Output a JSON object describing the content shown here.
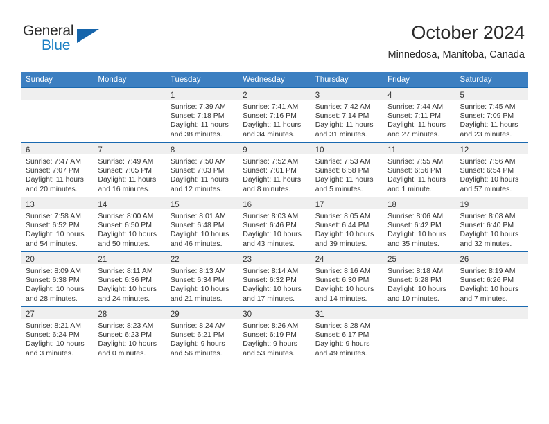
{
  "brand": {
    "name_part1": "General",
    "name_part2": "Blue",
    "accent_color": "#1b7fc4",
    "triangle_color": "#1665ab"
  },
  "header": {
    "title": "October 2024",
    "subtitle": "Minnedosa, Manitoba, Canada"
  },
  "calendar": {
    "header_bg": "#3c7fc1",
    "row_border_color": "#1a69b0",
    "daynum_band_bg": "#efefef",
    "weekdays": [
      "Sunday",
      "Monday",
      "Tuesday",
      "Wednesday",
      "Thursday",
      "Friday",
      "Saturday"
    ],
    "weeks": [
      [
        {
          "day": "",
          "lines": []
        },
        {
          "day": "",
          "lines": []
        },
        {
          "day": "1",
          "lines": [
            "Sunrise: 7:39 AM",
            "Sunset: 7:18 PM",
            "Daylight: 11 hours",
            "and 38 minutes."
          ]
        },
        {
          "day": "2",
          "lines": [
            "Sunrise: 7:41 AM",
            "Sunset: 7:16 PM",
            "Daylight: 11 hours",
            "and 34 minutes."
          ]
        },
        {
          "day": "3",
          "lines": [
            "Sunrise: 7:42 AM",
            "Sunset: 7:14 PM",
            "Daylight: 11 hours",
            "and 31 minutes."
          ]
        },
        {
          "day": "4",
          "lines": [
            "Sunrise: 7:44 AM",
            "Sunset: 7:11 PM",
            "Daylight: 11 hours",
            "and 27 minutes."
          ]
        },
        {
          "day": "5",
          "lines": [
            "Sunrise: 7:45 AM",
            "Sunset: 7:09 PM",
            "Daylight: 11 hours",
            "and 23 minutes."
          ]
        }
      ],
      [
        {
          "day": "6",
          "lines": [
            "Sunrise: 7:47 AM",
            "Sunset: 7:07 PM",
            "Daylight: 11 hours",
            "and 20 minutes."
          ]
        },
        {
          "day": "7",
          "lines": [
            "Sunrise: 7:49 AM",
            "Sunset: 7:05 PM",
            "Daylight: 11 hours",
            "and 16 minutes."
          ]
        },
        {
          "day": "8",
          "lines": [
            "Sunrise: 7:50 AM",
            "Sunset: 7:03 PM",
            "Daylight: 11 hours",
            "and 12 minutes."
          ]
        },
        {
          "day": "9",
          "lines": [
            "Sunrise: 7:52 AM",
            "Sunset: 7:01 PM",
            "Daylight: 11 hours",
            "and 8 minutes."
          ]
        },
        {
          "day": "10",
          "lines": [
            "Sunrise: 7:53 AM",
            "Sunset: 6:58 PM",
            "Daylight: 11 hours",
            "and 5 minutes."
          ]
        },
        {
          "day": "11",
          "lines": [
            "Sunrise: 7:55 AM",
            "Sunset: 6:56 PM",
            "Daylight: 11 hours",
            "and 1 minute."
          ]
        },
        {
          "day": "12",
          "lines": [
            "Sunrise: 7:56 AM",
            "Sunset: 6:54 PM",
            "Daylight: 10 hours",
            "and 57 minutes."
          ]
        }
      ],
      [
        {
          "day": "13",
          "lines": [
            "Sunrise: 7:58 AM",
            "Sunset: 6:52 PM",
            "Daylight: 10 hours",
            "and 54 minutes."
          ]
        },
        {
          "day": "14",
          "lines": [
            "Sunrise: 8:00 AM",
            "Sunset: 6:50 PM",
            "Daylight: 10 hours",
            "and 50 minutes."
          ]
        },
        {
          "day": "15",
          "lines": [
            "Sunrise: 8:01 AM",
            "Sunset: 6:48 PM",
            "Daylight: 10 hours",
            "and 46 minutes."
          ]
        },
        {
          "day": "16",
          "lines": [
            "Sunrise: 8:03 AM",
            "Sunset: 6:46 PM",
            "Daylight: 10 hours",
            "and 43 minutes."
          ]
        },
        {
          "day": "17",
          "lines": [
            "Sunrise: 8:05 AM",
            "Sunset: 6:44 PM",
            "Daylight: 10 hours",
            "and 39 minutes."
          ]
        },
        {
          "day": "18",
          "lines": [
            "Sunrise: 8:06 AM",
            "Sunset: 6:42 PM",
            "Daylight: 10 hours",
            "and 35 minutes."
          ]
        },
        {
          "day": "19",
          "lines": [
            "Sunrise: 8:08 AM",
            "Sunset: 6:40 PM",
            "Daylight: 10 hours",
            "and 32 minutes."
          ]
        }
      ],
      [
        {
          "day": "20",
          "lines": [
            "Sunrise: 8:09 AM",
            "Sunset: 6:38 PM",
            "Daylight: 10 hours",
            "and 28 minutes."
          ]
        },
        {
          "day": "21",
          "lines": [
            "Sunrise: 8:11 AM",
            "Sunset: 6:36 PM",
            "Daylight: 10 hours",
            "and 24 minutes."
          ]
        },
        {
          "day": "22",
          "lines": [
            "Sunrise: 8:13 AM",
            "Sunset: 6:34 PM",
            "Daylight: 10 hours",
            "and 21 minutes."
          ]
        },
        {
          "day": "23",
          "lines": [
            "Sunrise: 8:14 AM",
            "Sunset: 6:32 PM",
            "Daylight: 10 hours",
            "and 17 minutes."
          ]
        },
        {
          "day": "24",
          "lines": [
            "Sunrise: 8:16 AM",
            "Sunset: 6:30 PM",
            "Daylight: 10 hours",
            "and 14 minutes."
          ]
        },
        {
          "day": "25",
          "lines": [
            "Sunrise: 8:18 AM",
            "Sunset: 6:28 PM",
            "Daylight: 10 hours",
            "and 10 minutes."
          ]
        },
        {
          "day": "26",
          "lines": [
            "Sunrise: 8:19 AM",
            "Sunset: 6:26 PM",
            "Daylight: 10 hours",
            "and 7 minutes."
          ]
        }
      ],
      [
        {
          "day": "27",
          "lines": [
            "Sunrise: 8:21 AM",
            "Sunset: 6:24 PM",
            "Daylight: 10 hours",
            "and 3 minutes."
          ]
        },
        {
          "day": "28",
          "lines": [
            "Sunrise: 8:23 AM",
            "Sunset: 6:23 PM",
            "Daylight: 10 hours",
            "and 0 minutes."
          ]
        },
        {
          "day": "29",
          "lines": [
            "Sunrise: 8:24 AM",
            "Sunset: 6:21 PM",
            "Daylight: 9 hours",
            "and 56 minutes."
          ]
        },
        {
          "day": "30",
          "lines": [
            "Sunrise: 8:26 AM",
            "Sunset: 6:19 PM",
            "Daylight: 9 hours",
            "and 53 minutes."
          ]
        },
        {
          "day": "31",
          "lines": [
            "Sunrise: 8:28 AM",
            "Sunset: 6:17 PM",
            "Daylight: 9 hours",
            "and 49 minutes."
          ]
        },
        {
          "day": "",
          "lines": []
        },
        {
          "day": "",
          "lines": []
        }
      ]
    ]
  }
}
